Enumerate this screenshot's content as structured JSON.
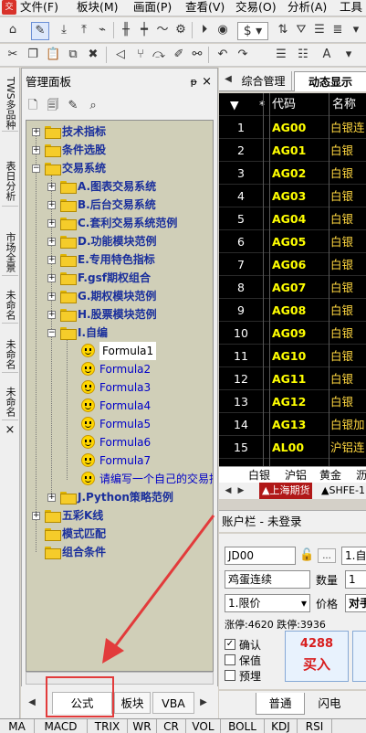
{
  "menubar": {
    "items": [
      "文件(F)",
      "板块(M)",
      "画面(P)",
      "查看(V)",
      "交易(O)",
      "分析(A)",
      "工具"
    ]
  },
  "toolbar": {
    "currency_symbol": "$"
  },
  "left_strip": {
    "tabs": [
      "TWS多品种",
      "表日分析",
      "市场全景",
      "未命名",
      "未命名",
      "未命名"
    ],
    "close": "×"
  },
  "panel": {
    "title": "管理面板",
    "title_buttons": [
      "ᵽ",
      "×"
    ],
    "tree": [
      {
        "label": "技术指标",
        "level": 0,
        "expander": "+"
      },
      {
        "label": "条件选股",
        "level": 0,
        "expander": "+"
      },
      {
        "label": "交易系统",
        "level": 0,
        "expander": "−"
      },
      {
        "label": "A.图表交易系统",
        "level": 1,
        "expander": "+"
      },
      {
        "label": "B.后台交易系统",
        "level": 1,
        "expander": "+"
      },
      {
        "label": "C.套利交易系统范例",
        "level": 1,
        "expander": "+"
      },
      {
        "label": "D.功能模块范例",
        "level": 1,
        "expander": "+"
      },
      {
        "label": "E.专用特色指标",
        "level": 1,
        "expander": "+"
      },
      {
        "label": "F.gsf期权组合",
        "level": 1,
        "expander": "+"
      },
      {
        "label": "G.期权模块范例",
        "level": 1,
        "expander": "+"
      },
      {
        "label": "H.股票模块范例",
        "level": 1,
        "expander": "+"
      },
      {
        "label": "I.自编",
        "level": 1,
        "expander": "−"
      },
      {
        "label": "Formula1",
        "level": 2,
        "leaf": true,
        "selected": true
      },
      {
        "label": "Formula2",
        "level": 2,
        "leaf": true
      },
      {
        "label": "Formula3",
        "level": 2,
        "leaf": true
      },
      {
        "label": "Formula4",
        "level": 2,
        "leaf": true
      },
      {
        "label": "Formula5",
        "level": 2,
        "leaf": true
      },
      {
        "label": "Formula6",
        "level": 2,
        "leaf": true
      },
      {
        "label": "Formula7",
        "level": 2,
        "leaf": true
      },
      {
        "label": "请编写一个自己的交易指",
        "level": 2,
        "leaf": true
      },
      {
        "label": "J.Python策略范例",
        "level": 1,
        "expander": "+"
      },
      {
        "label": "五彩K线",
        "level": 0,
        "expander": "+"
      },
      {
        "label": "模式匹配",
        "level": 0,
        "expander": ""
      },
      {
        "label": "组合条件",
        "level": 0,
        "expander": ""
      }
    ],
    "bottom_tabs": [
      "公式",
      "板块",
      "VBA"
    ]
  },
  "quote": {
    "tabs": [
      "综合管理",
      "动态显示"
    ],
    "header": {
      "sort": "▼",
      "star": "*",
      "code": "代码",
      "name": "名称"
    },
    "rows": [
      {
        "idx": "1",
        "code": "AG00",
        "name": "白银连"
      },
      {
        "idx": "2",
        "code": "AG01",
        "name": "白银"
      },
      {
        "idx": "3",
        "code": "AG02",
        "name": "白银"
      },
      {
        "idx": "4",
        "code": "AG03",
        "name": "白银"
      },
      {
        "idx": "5",
        "code": "AG04",
        "name": "白银"
      },
      {
        "idx": "6",
        "code": "AG05",
        "name": "白银"
      },
      {
        "idx": "7",
        "code": "AG06",
        "name": "白银"
      },
      {
        "idx": "8",
        "code": "AG07",
        "name": "白银"
      },
      {
        "idx": "9",
        "code": "AG08",
        "name": "白银"
      },
      {
        "idx": "10",
        "code": "AG09",
        "name": "白银"
      },
      {
        "idx": "11",
        "code": "AG10",
        "name": "白银"
      },
      {
        "idx": "12",
        "code": "AG11",
        "name": "白银"
      },
      {
        "idx": "13",
        "code": "AG12",
        "name": "白银"
      },
      {
        "idx": "14",
        "code": "AG13",
        "name": "白银加"
      },
      {
        "idx": "15",
        "code": "AL00",
        "name": "沪铝连"
      }
    ],
    "categories": [
      "白银",
      "沪铝",
      "黄金",
      "沥"
    ],
    "markets": [
      "▲上海期货",
      "▲SHFE-1"
    ]
  },
  "account": {
    "title": "账户栏 - 未登录",
    "account_id": "JD00",
    "contract_prefix": "1.自",
    "strategy_name": "鸡蛋连续",
    "qty_label": "数量",
    "qty_value": "1",
    "order_type": "1.限价",
    "price_label": "价格",
    "price_value": "对手",
    "limit_text": "涨停:4620 跌停:3936",
    "checkboxes": [
      {
        "label": "确认",
        "checked": true
      },
      {
        "label": "保值",
        "checked": false
      },
      {
        "label": "预埋",
        "checked": false
      }
    ],
    "buy_price": "4288",
    "buy_label": "买入",
    "tabs": [
      "普通",
      "闪电"
    ]
  },
  "indicators": [
    "MA",
    "MACD",
    "TRIX",
    "WR",
    "CR",
    "VOL",
    "BOLL",
    "KDJ",
    "RSI"
  ]
}
